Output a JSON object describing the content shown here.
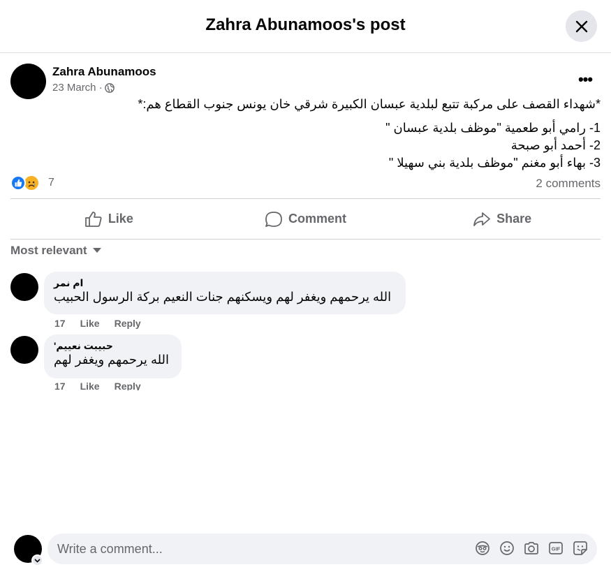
{
  "header": {
    "title": "Zahra Abunamoos's post",
    "close_icon": "close-icon"
  },
  "post": {
    "author": "Zahra Abunamoos",
    "date": "23 March ·",
    "privacy_icon": "globe-icon",
    "body_intro": "*شهداء القصف على مركبة تتبع لبلدية عبسان الكبيرة شرقي خان يونس جنوب القطاع هم:*",
    "body_lines": [
      "1- رامي أبو طعمية \"موظف بلدية عبسان \"",
      "2- أحمد أبو صبحة",
      "3- بهاء أبو مغنم  \"موظف بلدية بني سهيلا \""
    ],
    "reactions": {
      "icons": [
        "like-icon",
        "sad-icon"
      ],
      "count": "7"
    },
    "comments_count": "2 comments"
  },
  "actions": {
    "like": "Like",
    "comment": "Comment",
    "share": "Share"
  },
  "sort": {
    "label": "Most relevant",
    "icon": "caret-down-icon"
  },
  "comments": [
    {
      "name": "ام نمر",
      "text": "الله يرحمهم ويغفر لهم ويسكنهم جنات النعيم بركة الرسول الحبيب",
      "time": "17",
      "like": "Like",
      "reply": "Reply"
    },
    {
      "name": "حبيبت نعييم'",
      "text": "الله يرحمهم ويغفر لهم",
      "time": "17",
      "like": "Like",
      "reply": "Reply"
    }
  ],
  "composer": {
    "placeholder": "Write a comment...",
    "icons": [
      "avatar-emoji-icon",
      "emoji-icon",
      "camera-icon",
      "gif-icon",
      "sticker-icon"
    ]
  },
  "colors": {
    "primary": "#1877f2",
    "secondary_text": "#65676b",
    "bubble": "#f0f2f5",
    "sad": "#f7b125"
  }
}
